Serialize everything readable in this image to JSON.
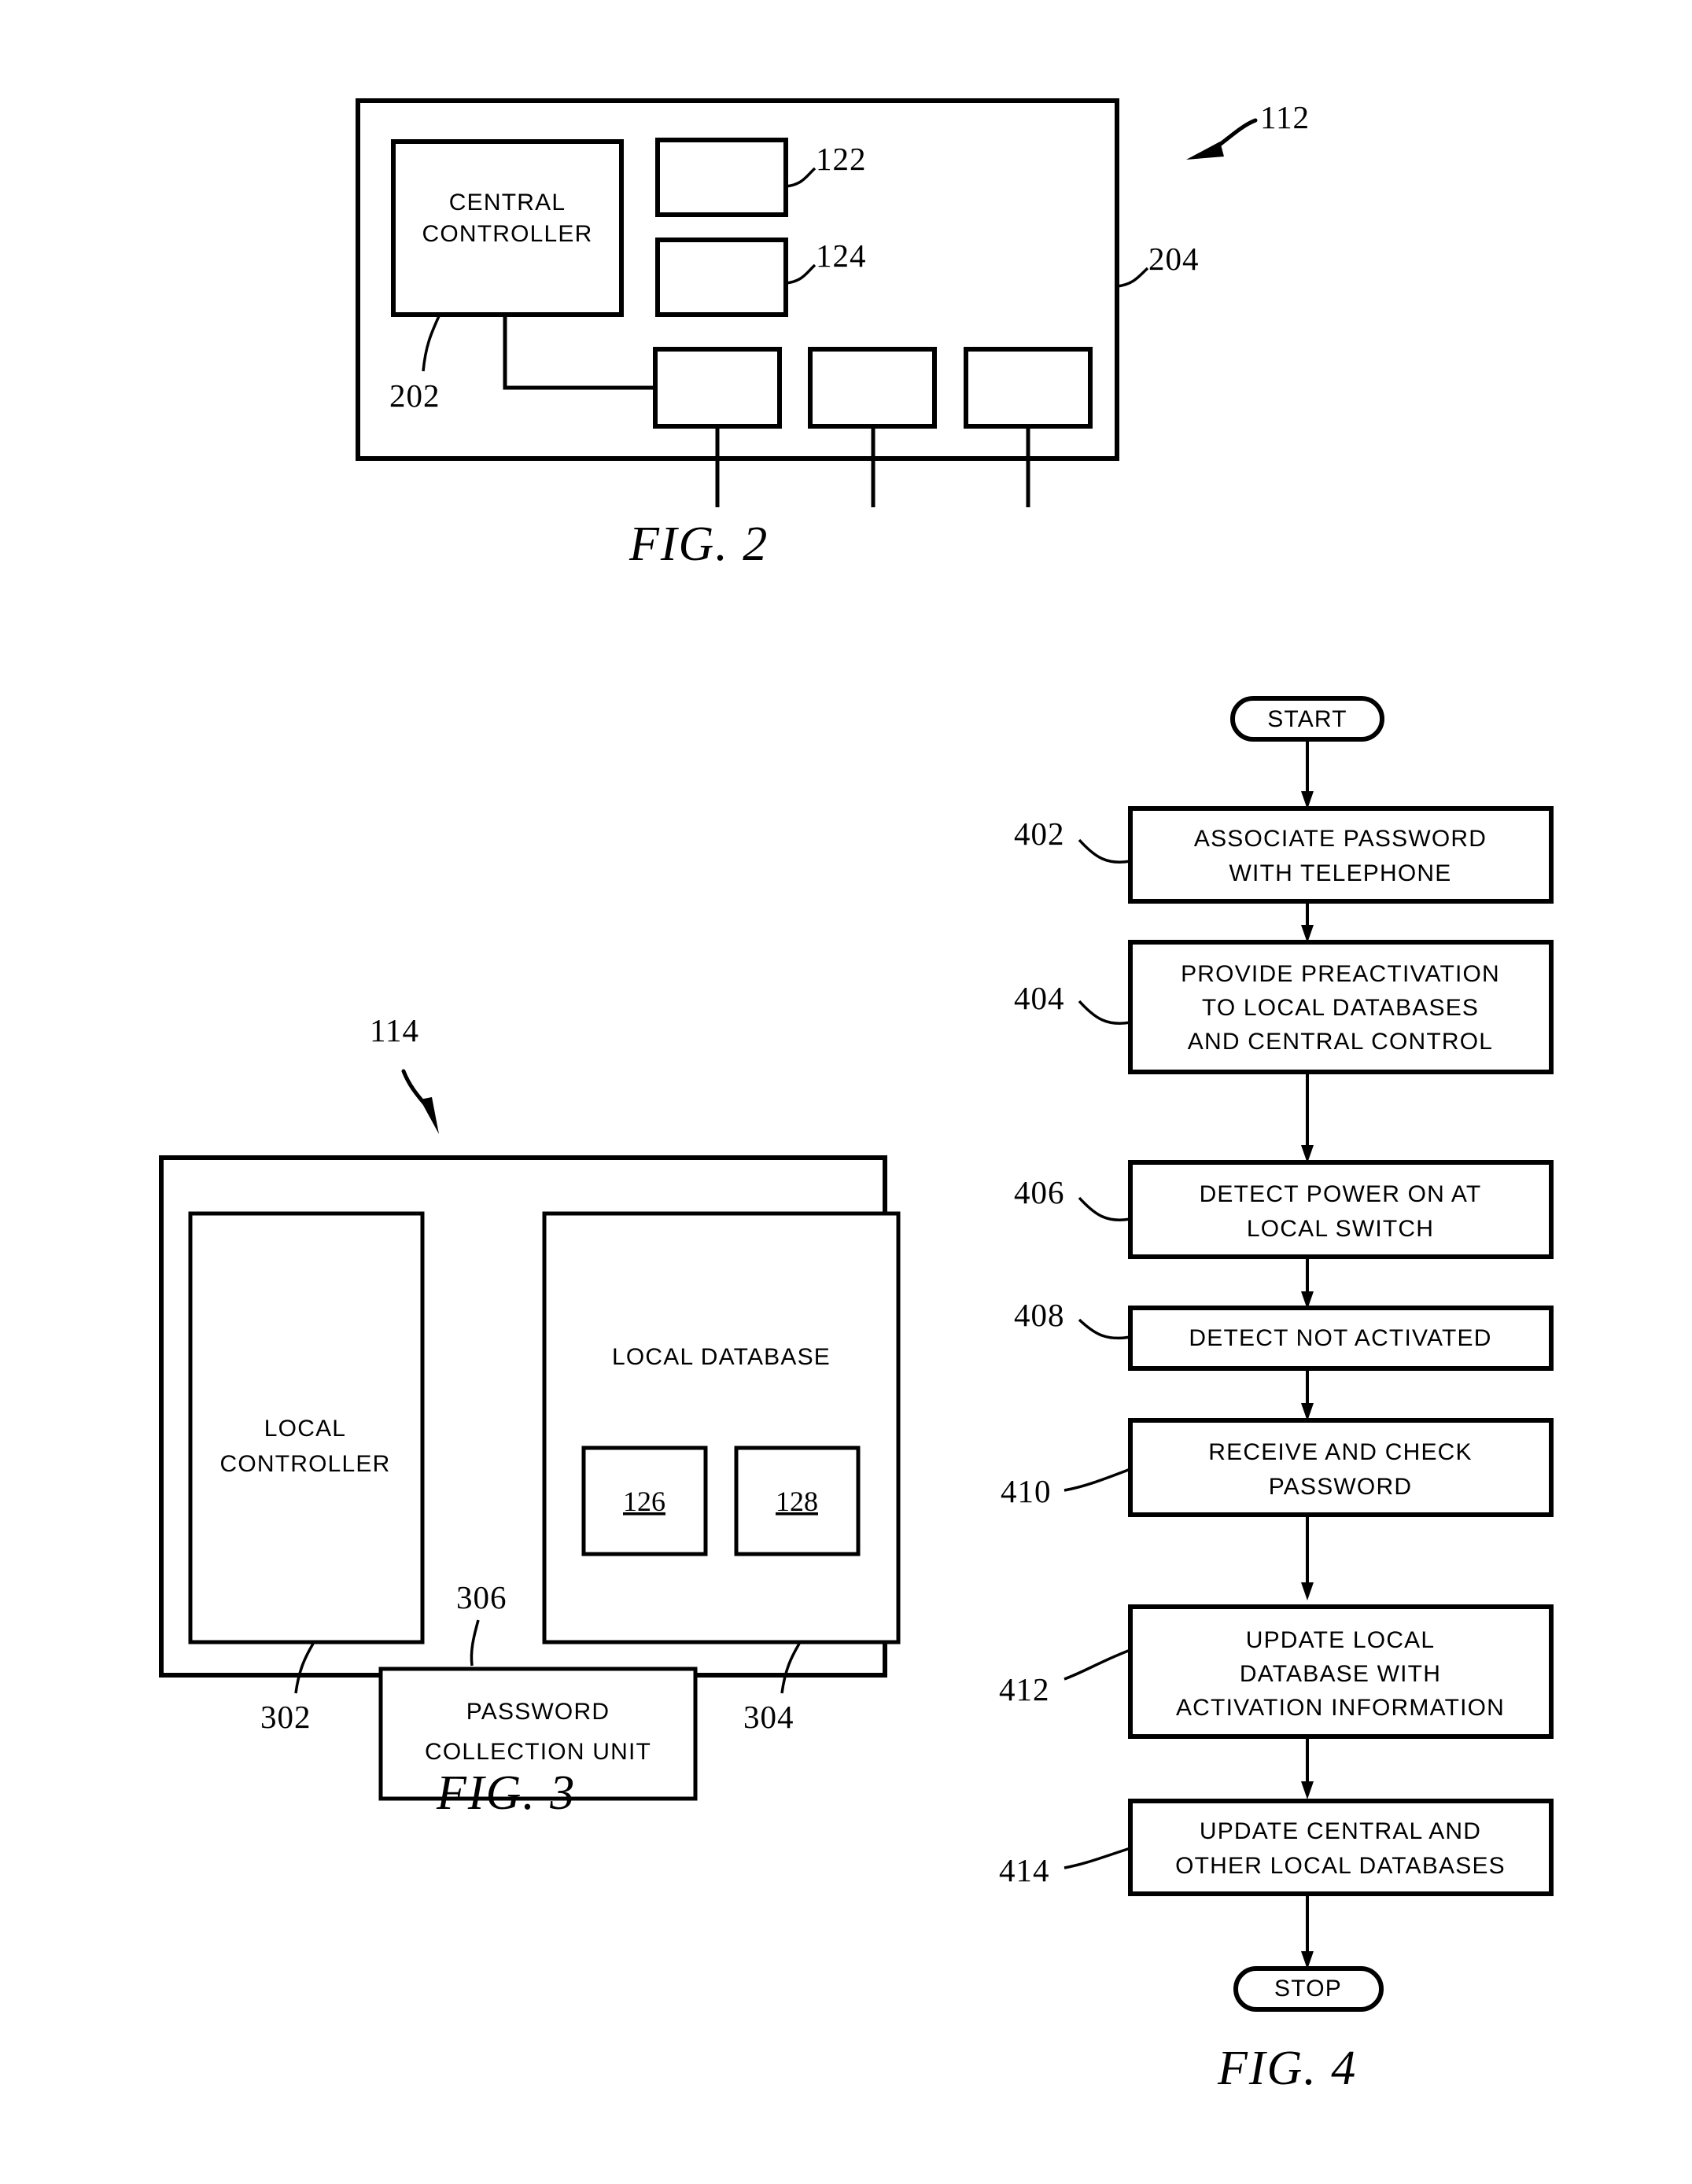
{
  "document": {
    "type": "patent-drawing-sheet",
    "figures": [
      "FIG. 2",
      "FIG. 3",
      "FIG. 4"
    ]
  },
  "fig2": {
    "caption": "FIG.  2",
    "system_ref": "112",
    "outer_box_ref": "204",
    "central_controller_label": "CENTRAL CONTROLLER",
    "central_controller_line1": "CENTRAL",
    "central_controller_line2": "CONTROLLER",
    "central_controller_ref": "202",
    "right_box_refs": [
      "122",
      "124"
    ],
    "bottom_boxes": [
      "",
      "",
      ""
    ]
  },
  "fig3": {
    "caption": "FIG.  3",
    "system_ref": "114",
    "local_controller_line1": "LOCAL",
    "local_controller_line2": "CONTROLLER",
    "local_controller_ref": "302",
    "local_database_label": "LOCAL DATABASE",
    "local_database_ref": "304",
    "database_entries": [
      "126",
      "128"
    ],
    "password_unit_line1": "PASSWORD",
    "password_unit_line2": "COLLECTION UNIT",
    "password_unit_ref": "306"
  },
  "fig4": {
    "caption": "FIG.  4",
    "start_label": "START",
    "stop_label": "STOP",
    "steps": [
      {
        "ref": "402",
        "lines": [
          "ASSOCIATE PASSWORD",
          "WITH TELEPHONE"
        ]
      },
      {
        "ref": "404",
        "lines": [
          "PROVIDE PREACTIVATION",
          "TO LOCAL DATABASES",
          "AND CENTRAL CONTROL"
        ]
      },
      {
        "ref": "406",
        "lines": [
          "DETECT POWER ON AT",
          "LOCAL SWITCH"
        ]
      },
      {
        "ref": "408",
        "lines": [
          "DETECT NOT ACTIVATED"
        ]
      },
      {
        "ref": "410",
        "lines": [
          "RECEIVE AND CHECK",
          "PASSWORD"
        ]
      },
      {
        "ref": "412",
        "lines": [
          "UPDATE LOCAL",
          "DATABASE WITH",
          "ACTIVATION INFORMATION"
        ]
      },
      {
        "ref": "414",
        "lines": [
          "UPDATE CENTRAL AND",
          "OTHER LOCAL DATABASES"
        ]
      }
    ]
  },
  "colors": {
    "ink": "#000000",
    "paper": "#ffffff"
  }
}
